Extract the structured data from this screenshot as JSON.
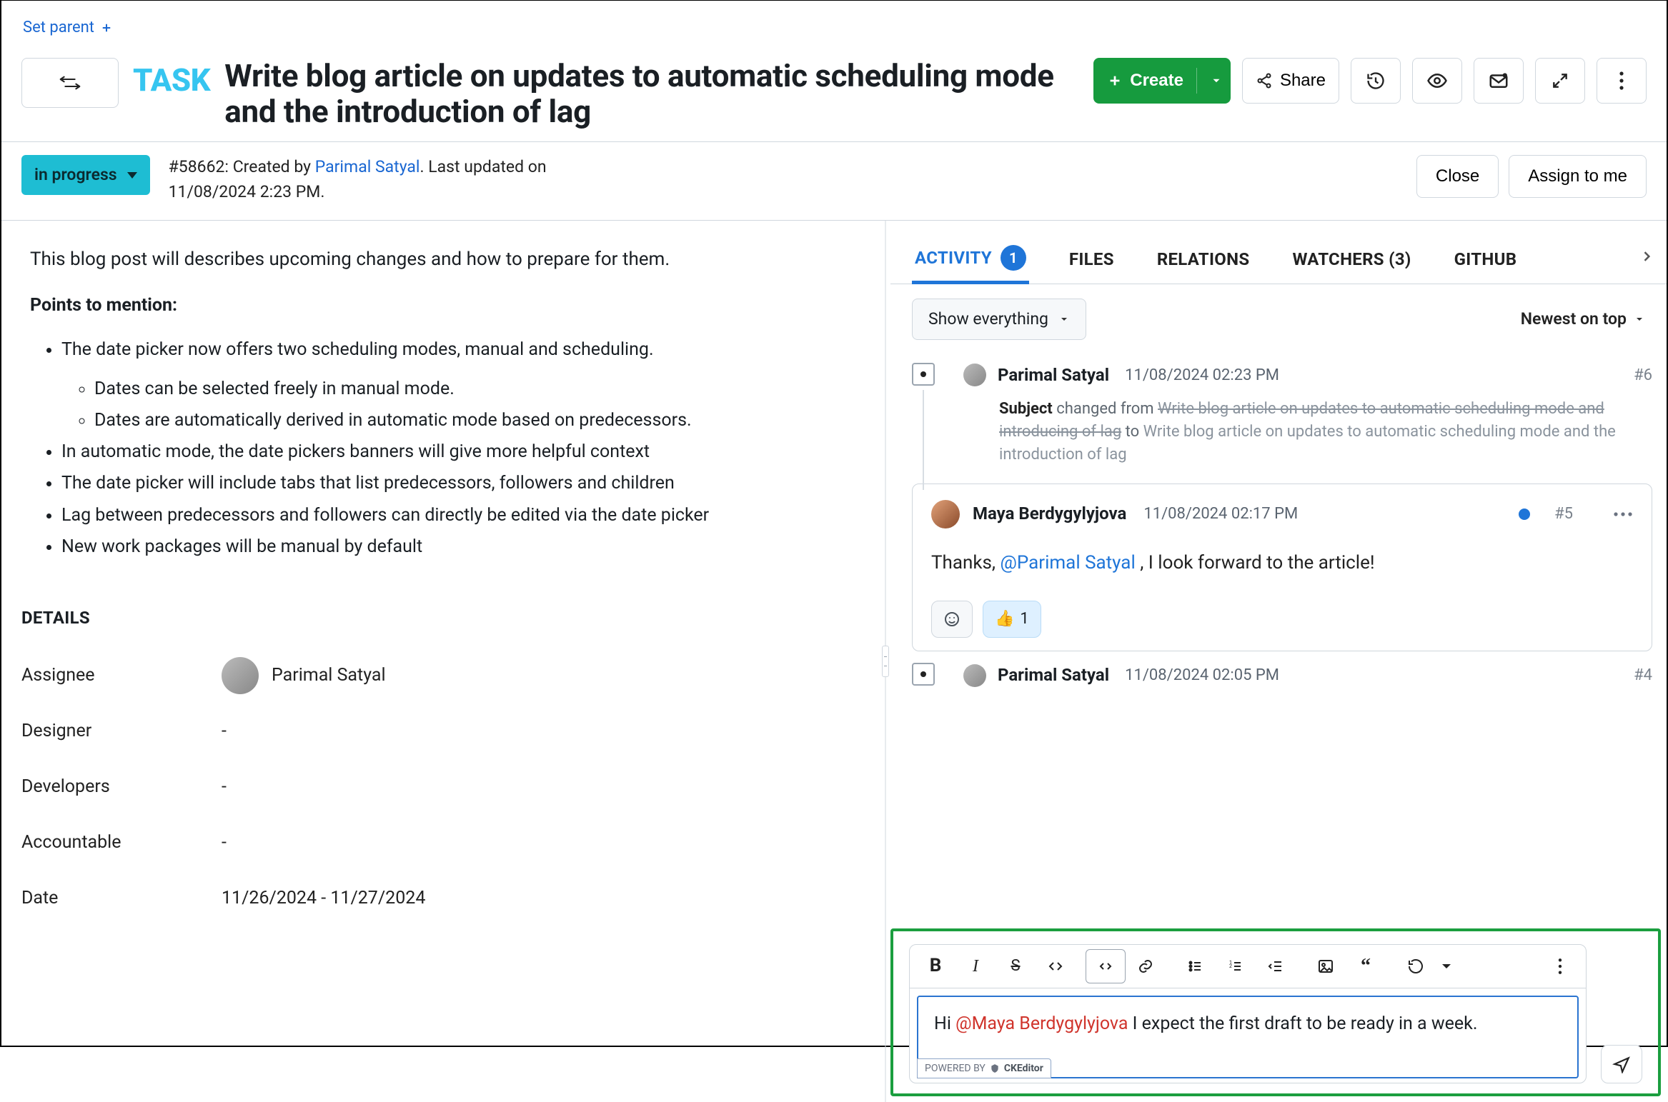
{
  "setParent": "Set parent",
  "type": "TASK",
  "title": "Write blog article on updates to automatic scheduling mode and the introduction of lag",
  "primaryAction": "Create",
  "shareLabel": "Share",
  "status": "in progress",
  "meta": {
    "prefix": "#58662: Created by ",
    "author": "Parimal Satyal",
    "suffix": ". Last updated on 11/08/2024 2:23 PM."
  },
  "closeLabel": "Close",
  "assignLabel": "Assign to me",
  "description": {
    "intro": "This blog post will describes upcoming changes and how to prepare for them.",
    "pointsTitle": "Points to mention:",
    "bullets": [
      "The date picker now offers two scheduling modes, manual and scheduling.",
      "In automatic mode, the date pickers banners will give more helpful context",
      "The date picker will include tabs that list predecessors, followers and children",
      "Lag between predecessors and followers can directly be edited via the date picker",
      "New work packages will be manual by default"
    ],
    "subbullets": [
      "Dates can be selected freely in manual mode.",
      "Dates are automatically derived in automatic mode based on predecessors."
    ]
  },
  "detailsTitle": "DETAILS",
  "details": {
    "assigneeLabel": "Assignee",
    "assigneeValue": "Parimal Satyal",
    "designerLabel": "Designer",
    "designerValue": "-",
    "developersLabel": "Developers",
    "developersValue": "-",
    "accountableLabel": "Accountable",
    "accountableValue": "-",
    "dateLabel": "Date",
    "dateValue": "11/26/2024 - 11/27/2024"
  },
  "tabs": {
    "activity": "ACTIVITY",
    "activityBadge": "1",
    "files": "FILES",
    "relations": "RELATIONS",
    "watchers": "WATCHERS (3)",
    "github": "GITHUB"
  },
  "filter": "Show everything",
  "sort": "Newest on top",
  "activity": {
    "e6": {
      "who": "Parimal Satyal",
      "when": "11/08/2024 02:23 PM",
      "anchor": "#6",
      "label": "Subject",
      "mid1": " changed from ",
      "old": "Write blog article on updates to automatic scheduling mode and introducing of lag",
      "mid2": " to ",
      "new": "Write blog article on updates to automatic scheduling mode and the introduction of lag"
    },
    "e5": {
      "who": "Maya Berdygylyjova",
      "when": "11/08/2024 02:17 PM",
      "anchor": "#5",
      "textPre": "Thanks, ",
      "mention": "@Parimal Satyal",
      "textPost": " , I look forward to the article!",
      "reactCount": "1"
    },
    "e4": {
      "who": "Parimal Satyal",
      "when": "11/08/2024 02:05 PM",
      "anchor": "#4"
    }
  },
  "composer": {
    "pre": "Hi ",
    "mention": "@Maya Berdygylyjova",
    "post": " I expect the first draft to be ready in a week.",
    "powered": "POWERED BY",
    "brand": "CKEditor"
  }
}
